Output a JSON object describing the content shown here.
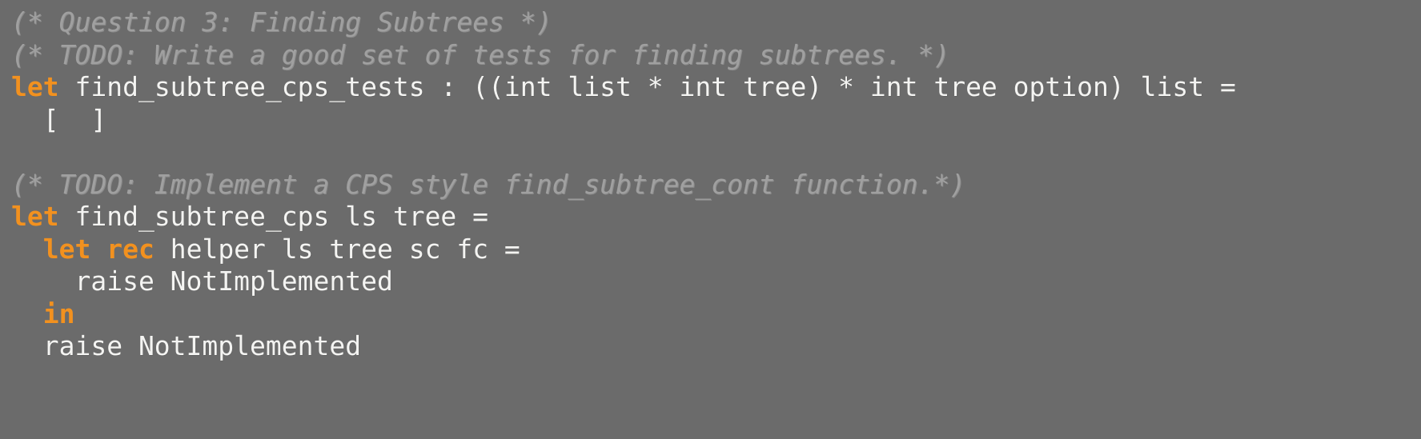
{
  "editor": {
    "language": "OCaml",
    "background_color": "#6b6b6b",
    "comment_color": "#a0a0a0",
    "keyword_color": "#f2911f",
    "text_color": "#f4f4f2"
  },
  "code": {
    "lines": [
      {
        "id": "line-1",
        "kind": "comment",
        "tokens": [
          {
            "type": "comment",
            "text": "(* Question 3: Finding Subtrees *)"
          }
        ]
      },
      {
        "id": "line-2",
        "kind": "comment",
        "tokens": [
          {
            "type": "comment",
            "text": "(* TODO: Write a good set of tests for finding subtrees. *)"
          }
        ]
      },
      {
        "id": "line-3",
        "kind": "code",
        "tokens": [
          {
            "type": "keyword",
            "text": "let"
          },
          {
            "type": "plain",
            "text": " find_subtree_cps_tests : ((int list * int tree) * int tree option) list ="
          }
        ]
      },
      {
        "id": "line-4",
        "kind": "code",
        "tokens": [
          {
            "type": "plain",
            "text": "  [  ]"
          }
        ]
      },
      {
        "id": "line-5",
        "kind": "blank",
        "tokens": [
          {
            "type": "plain",
            "text": " "
          }
        ]
      },
      {
        "id": "line-6",
        "kind": "comment",
        "tokens": [
          {
            "type": "comment",
            "text": "(* TODO: Implement a CPS style find_subtree_cont function.*)"
          }
        ]
      },
      {
        "id": "line-7",
        "kind": "code",
        "tokens": [
          {
            "type": "keyword",
            "text": "let"
          },
          {
            "type": "plain",
            "text": " find_subtree_cps ls tree ="
          }
        ]
      },
      {
        "id": "line-8",
        "kind": "code",
        "tokens": [
          {
            "type": "plain",
            "text": "  "
          },
          {
            "type": "keyword",
            "text": "let"
          },
          {
            "type": "plain",
            "text": " "
          },
          {
            "type": "keyword",
            "text": "rec"
          },
          {
            "type": "plain",
            "text": " helper ls tree sc fc ="
          }
        ]
      },
      {
        "id": "line-9",
        "kind": "code",
        "tokens": [
          {
            "type": "plain",
            "text": "    raise NotImplemented"
          }
        ]
      },
      {
        "id": "line-10",
        "kind": "code",
        "tokens": [
          {
            "type": "plain",
            "text": "  "
          },
          {
            "type": "keyword",
            "text": "in"
          }
        ]
      },
      {
        "id": "line-11",
        "kind": "code",
        "tokens": [
          {
            "type": "plain",
            "text": "  raise NotImplemented"
          }
        ]
      }
    ]
  }
}
